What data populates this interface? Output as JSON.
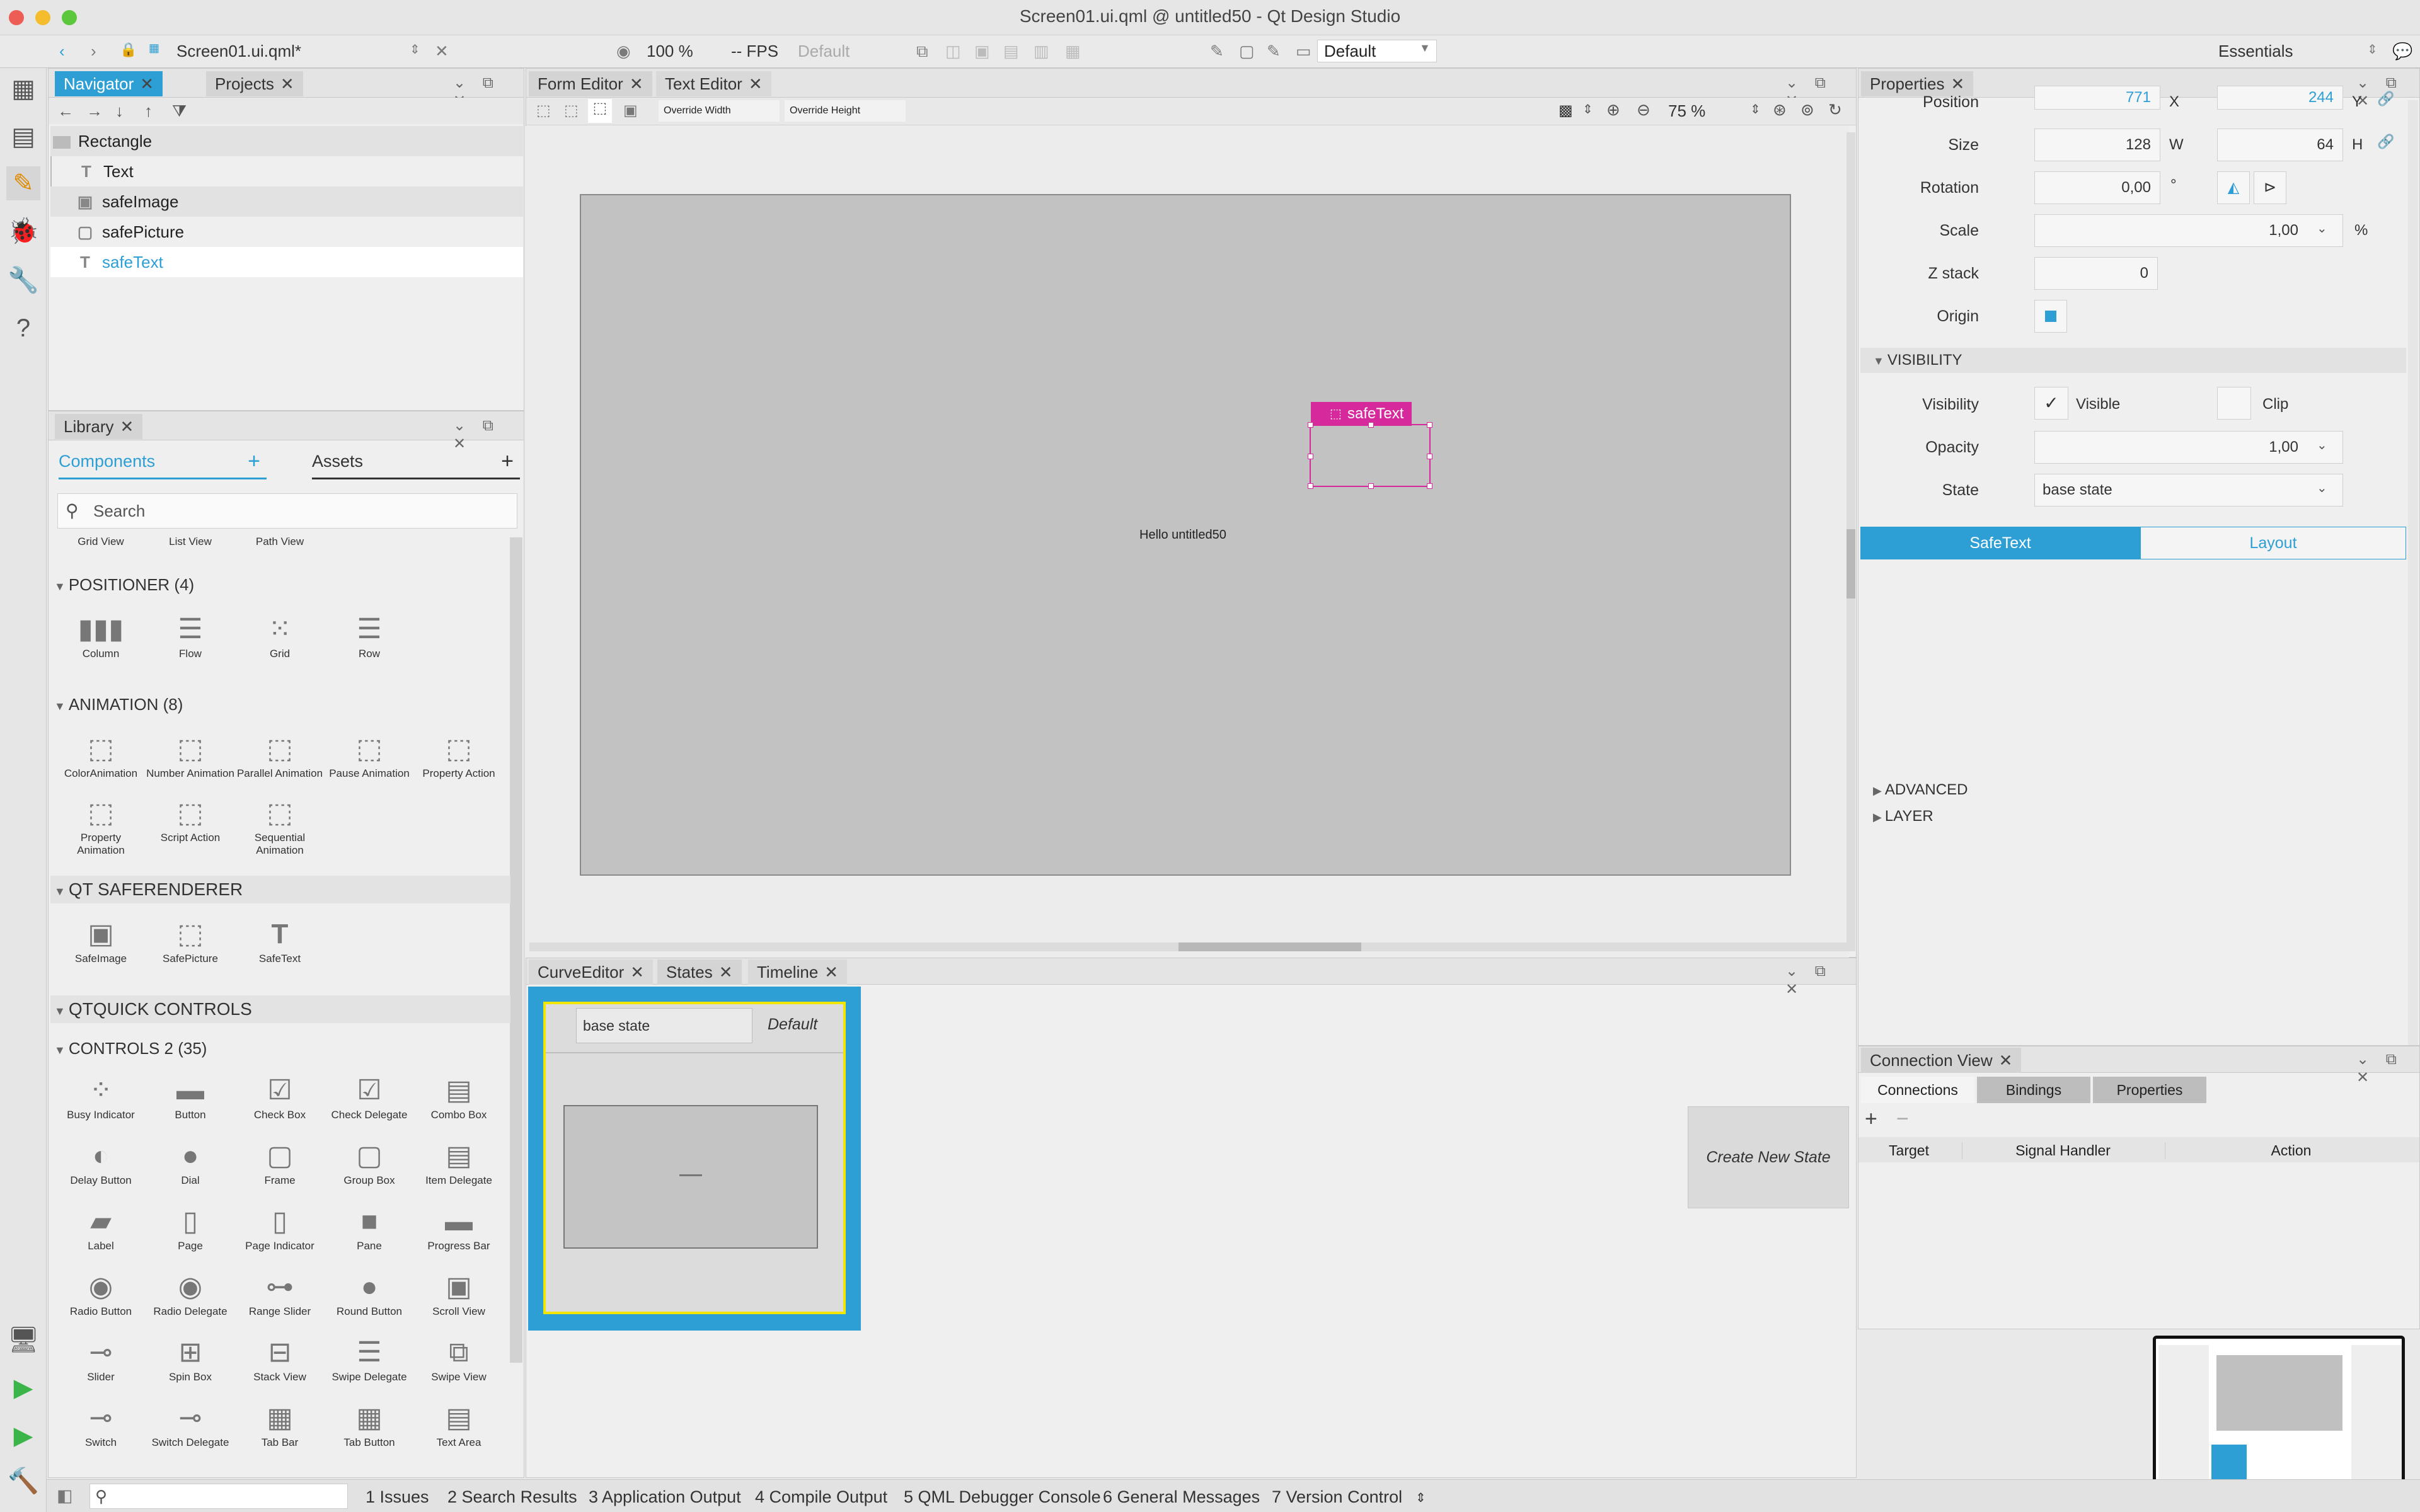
{
  "window": {
    "title": "Screen01.ui.qml @ untitled50 - Qt Design Studio"
  },
  "toolbar": {
    "file": "Screen01.ui.qml*",
    "zoom": "100 %",
    "fps": "-- FPS",
    "fps_default": "Default",
    "state_combo": "Default",
    "workspace": "Essentials"
  },
  "navigator": {
    "tab_navigator": "Navigator",
    "tab_projects": "Projects",
    "root": "Rectangle",
    "items": [
      "Text",
      "safeImage",
      "safePicture",
      "safeText"
    ]
  },
  "library": {
    "tab": "Library",
    "tab_components": "Components",
    "tab_assets": "Assets",
    "search_placeholder": "Search",
    "views": [
      "Grid View",
      "List View",
      "Path View"
    ],
    "positioner_header": "POSITIONER (4)",
    "positioner": [
      "Column",
      "Flow",
      "Grid",
      "Row"
    ],
    "animation_header": "ANIMATION (8)",
    "animation": [
      "ColorAnimation",
      "Number Animation",
      "Parallel Animation",
      "Pause Animation",
      "Property Action",
      "Property Animation",
      "Script Action",
      "Sequential Animation"
    ],
    "safe_header": "QT SAFERENDERER",
    "safe": [
      "SafeImage",
      "SafePicture",
      "SafeText"
    ],
    "qq_header": "QTQUICK CONTROLS",
    "controls_header": "CONTROLS 2 (35)",
    "controls": [
      "Busy Indicator",
      "Button",
      "Check Box",
      "Check Delegate",
      "Combo Box",
      "Delay Button",
      "Dial",
      "Frame",
      "Group Box",
      "Item Delegate",
      "Label",
      "Page",
      "Page Indicator",
      "Pane",
      "Progress Bar",
      "Radio Button",
      "Radio Delegate",
      "Range Slider",
      "Round Button",
      "Scroll View",
      "Slider",
      "Spin Box",
      "Stack View",
      "Swipe Delegate",
      "Swipe View",
      "Switch",
      "Switch Delegate",
      "Tab Bar",
      "Tab Button",
      "Text Area"
    ]
  },
  "editor": {
    "tab_form": "Form Editor",
    "tab_text": "Text Editor",
    "override_width": "Override Width",
    "override_height": "Override Height",
    "zoom": "75 %",
    "selection_label": "safeText",
    "canvas_text": "Hello untitled50"
  },
  "states_panel": {
    "tab_curve": "CurveEditor",
    "tab_states": "States",
    "tab_timeline": "Timeline",
    "state_name": "base state",
    "state_default": "Default",
    "create_button": "Create New State"
  },
  "properties": {
    "tab": "Properties",
    "position_label": "Position",
    "pos_x": "771",
    "pos_x_unit": "X",
    "pos_y": "244",
    "pos_y_unit": "Y",
    "size_label": "Size",
    "w": "128",
    "w_unit": "W",
    "h": "64",
    "h_unit": "H",
    "rotation_label": "Rotation",
    "rotation": "0,00",
    "rotation_unit": "°",
    "scale_label": "Scale",
    "scale": "1,00",
    "scale_unit": "%",
    "z_label": "Z stack",
    "z": "0",
    "origin_label": "Origin",
    "visibility_header": "VISIBILITY",
    "visibility_label": "Visibility",
    "visible_text": "Visible",
    "clip_text": "Clip",
    "opacity_label": "Opacity",
    "opacity": "1,00",
    "state_label": "State",
    "state_value": "base state",
    "tab_safetext": "SafeText",
    "tab_layout": "Layout",
    "advanced": "ADVANCED",
    "layer": "LAYER"
  },
  "connections": {
    "tab": "Connection View",
    "tab_connections": "Connections",
    "tab_bindings": "Bindings",
    "tab_properties": "Properties",
    "col_target": "Target",
    "col_signal": "Signal Handler",
    "col_action": "Action"
  },
  "statusbar": {
    "items": [
      "1  Issues",
      "2  Search Results",
      "3  Application Output",
      "4  Compile Output",
      "5  QML Debugger Console",
      "6  General Messages",
      "7  Version Control"
    ]
  },
  "colors": {
    "accent": "#2e9fd5",
    "selection": "#d62a9c",
    "state_border": "#f2e600"
  }
}
